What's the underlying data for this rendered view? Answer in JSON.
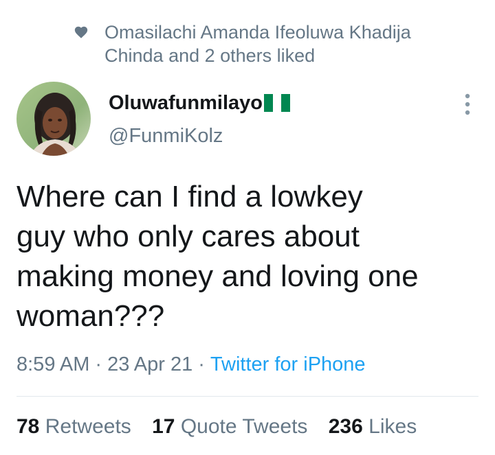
{
  "social_context": {
    "icon": "heart-icon",
    "text": "Omasilachi Amanda Ifeoluwa Khadija\nChinda and 2 others liked"
  },
  "author": {
    "avatar_icon": "profile-photo",
    "display_name": "Oluwafunmilayo",
    "flag_icon": "nigeria-flag-icon",
    "flag_colors": [
      "#008751",
      "#ffffff",
      "#008751"
    ],
    "handle": "@FunmiKolz"
  },
  "more_icon": "more-vertical-icon",
  "tweet": {
    "text": "Where can I find a lowkey\nguy who only cares about\nmaking money and loving one\nwoman???"
  },
  "meta": {
    "time": "8:59 AM",
    "separator": "·",
    "date": "23 Apr 21",
    "source": "Twitter for iPhone"
  },
  "stats": {
    "retweets_count": "78",
    "retweets_label": "Retweets",
    "quote_tweets_count": "17",
    "quote_tweets_label": "Quote Tweets",
    "likes_count": "236",
    "likes_label": "Likes"
  },
  "colors": {
    "primary_text": "#14171a",
    "secondary_text": "#657786",
    "link": "#1da1f2",
    "divider": "#e1e8ed"
  }
}
